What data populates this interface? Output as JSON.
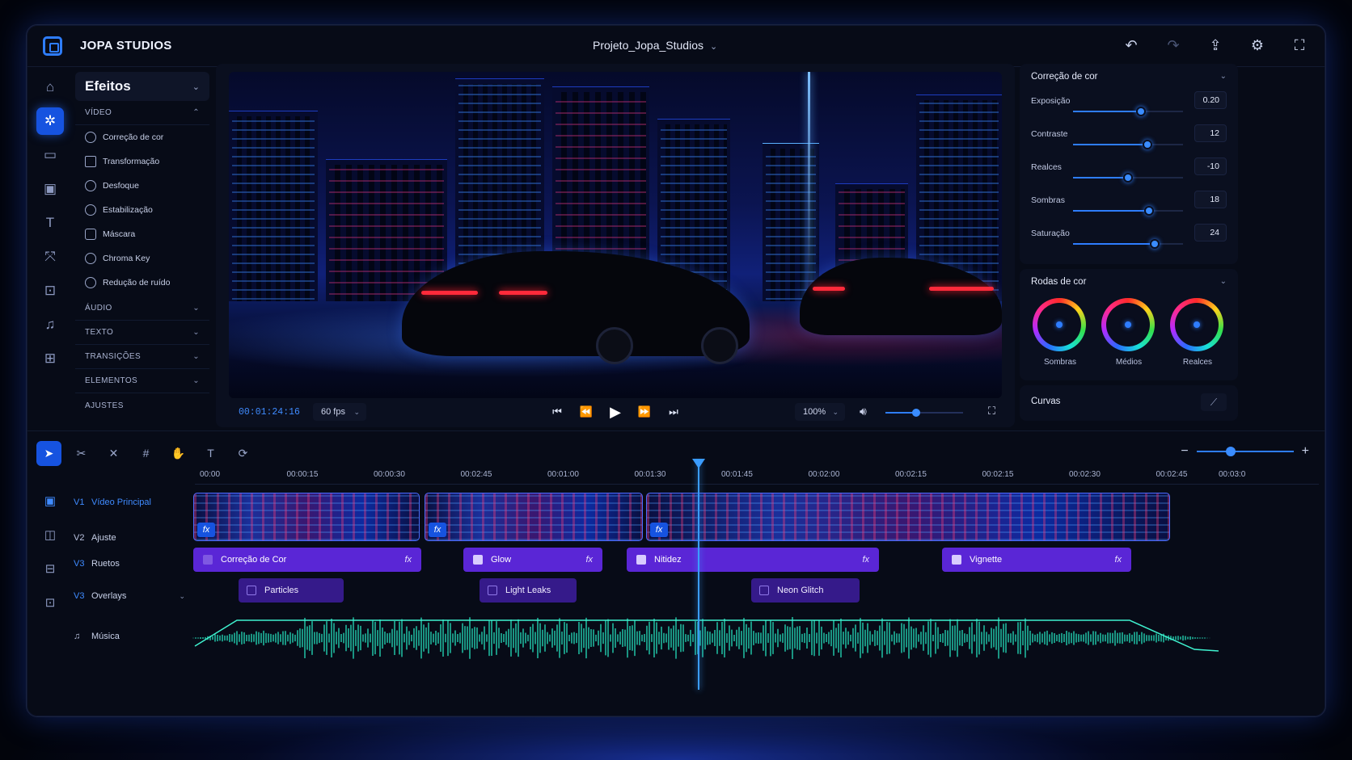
{
  "app": {
    "brand": "JOPA STUDIOS",
    "project": "Projeto_Jopa_Studios"
  },
  "topbar_icons": [
    "undo-icon",
    "redo-icon",
    "share-icon",
    "settings-icon",
    "fullscreen-icon"
  ],
  "rail_icons": [
    "home-icon",
    "effects-icon",
    "folder-icon",
    "media-icon",
    "text-icon",
    "transform-icon",
    "crop-icon",
    "audio-edit-icon",
    "export-icon"
  ],
  "effects": {
    "title": "Efeitos",
    "video_section": "VÍDEO",
    "items": [
      "Correção de cor",
      "Transformação",
      "Desfoque",
      "Estabilização",
      "Máscara",
      "Chroma Key",
      "Redução de ruído"
    ],
    "sections": [
      "ÁUDIO",
      "TEXTO",
      "TRANSIÇÕES",
      "ELEMENTOS"
    ],
    "adjust": "AJUSTES"
  },
  "player": {
    "timecode": "00:01:24:16",
    "fps": "60 fps",
    "zoom": "100%",
    "volume": 0.4
  },
  "color_correction": {
    "title": "Correção de cor",
    "adjustments": [
      {
        "label": "Exposição",
        "value": "0.20",
        "level": 0.62
      },
      {
        "label": "Contraste",
        "value": "12",
        "level": 0.68
      },
      {
        "label": "Realces",
        "value": "-10",
        "level": 0.5
      },
      {
        "label": "Sombras",
        "value": "18",
        "level": 0.69
      },
      {
        "label": "Saturação",
        "value": "24",
        "level": 0.74
      }
    ]
  },
  "color_wheels": {
    "title": "Rodas de cor",
    "wheels": [
      "Sombras",
      "Médios",
      "Realces"
    ]
  },
  "curves": {
    "title": "Curvas"
  },
  "timeline": {
    "zoom_level": 0.35,
    "ruler": [
      "00:00",
      "00:00:15",
      "00:00:30",
      "00:02:45",
      "00:01:00",
      "00:01:30",
      "00:01:45",
      "00:02:00",
      "00:02:15",
      "00:02:15",
      "00:02:30",
      "00:02:45",
      "00:03:0"
    ],
    "tracks": [
      {
        "id": "V1",
        "name": "Vídeo Principal"
      },
      {
        "id": "V2",
        "name": "Ajuste"
      },
      {
        "id": "V3",
        "name": "Ruetos"
      },
      {
        "id": "V3",
        "name": "Overlays"
      },
      {
        "id": "",
        "name": "Música"
      }
    ],
    "effect_clips": [
      "Correção de Cor",
      "Glow",
      "Nitidez",
      "Vignette"
    ],
    "overlay_clips": [
      "Particles",
      "Light Leaks",
      "Neon Glitch"
    ],
    "fx_label": "fx"
  }
}
